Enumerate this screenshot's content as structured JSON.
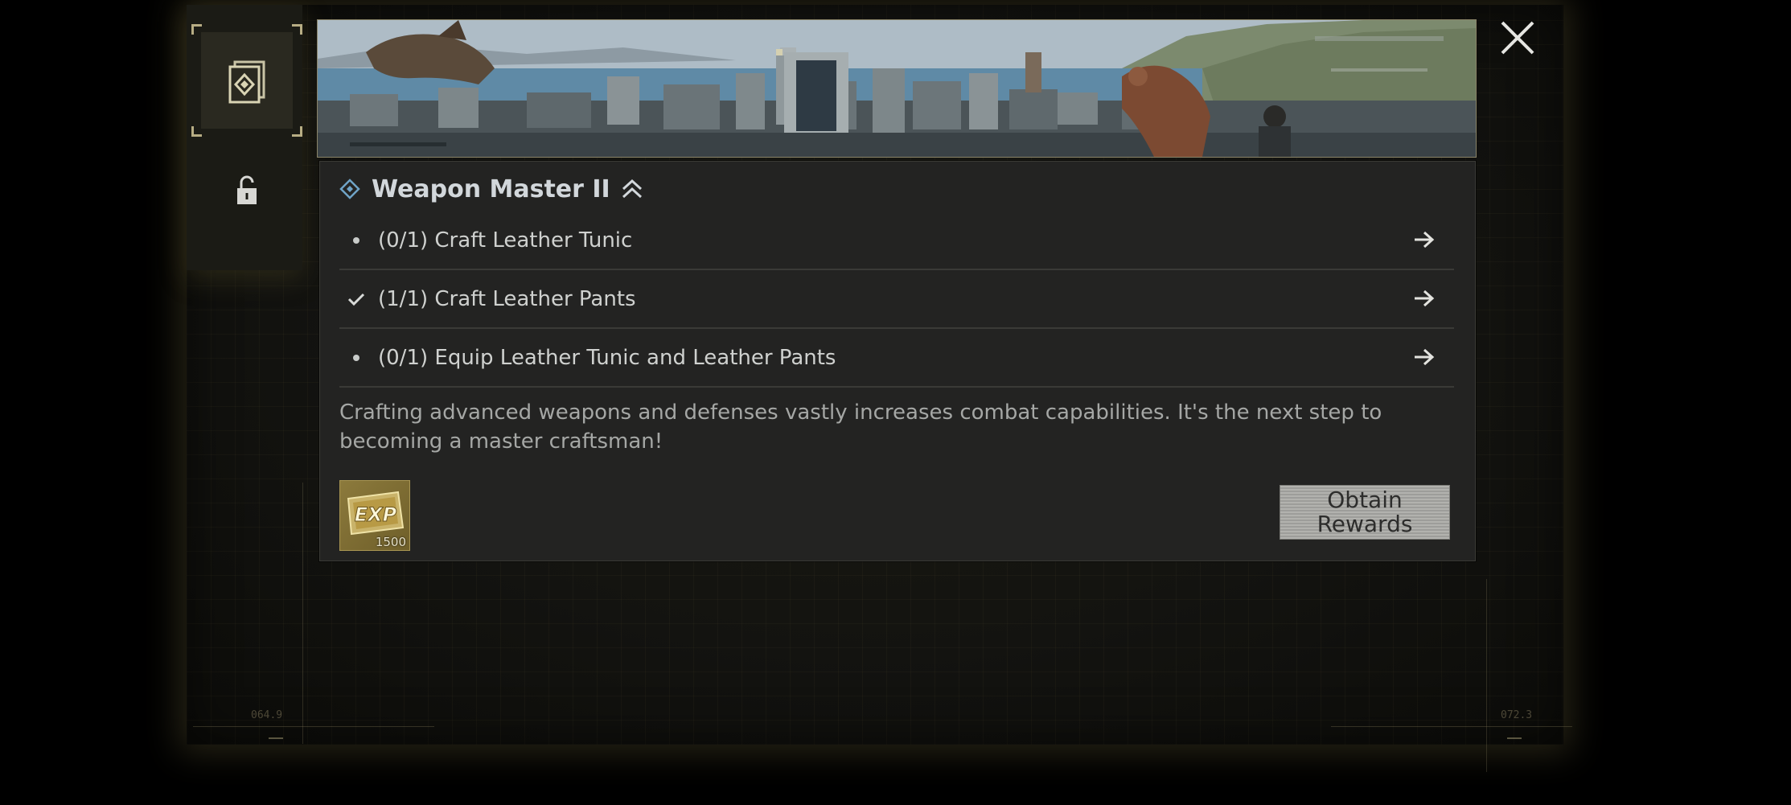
{
  "sidebar": {
    "tabs": [
      {
        "name": "quest-tab",
        "state": "active",
        "icon": "document-diamond-icon"
      },
      {
        "name": "locked-tab",
        "state": "locked",
        "icon": "lock-icon"
      }
    ]
  },
  "header": {
    "close_icon": "close-icon",
    "banner": "city-landscape-banner"
  },
  "quest": {
    "title": "Weapon Master II",
    "title_icon": "diamond-icon",
    "rank_icon": "double-chevron-up-icon",
    "tasks": [
      {
        "status": "pending",
        "text": "(0/1) Craft Leather Tunic",
        "icon": "arrow-right-icon"
      },
      {
        "status": "done",
        "text": "(1/1) Craft Leather Pants",
        "icon": "arrow-right-icon"
      },
      {
        "status": "pending",
        "text": "(0/1) Equip Leather Tunic and Leather Pants",
        "icon": "arrow-right-icon"
      }
    ],
    "description": "Crafting advanced weapons and defenses vastly increases combat capabilities. It's the next step to becoming a master craftsman!",
    "reward": {
      "label": "EXP",
      "quantity": "1500"
    },
    "obtain_button": "Obtain Rewards"
  },
  "hud": {
    "left_readout": "064.9",
    "right_readout": "072.3"
  },
  "colors": {
    "accent_gold": "#b7ad84",
    "panel_bg": "#232322",
    "title_text": "#d2d7db",
    "diamond_blue": "#6fa3c7"
  }
}
